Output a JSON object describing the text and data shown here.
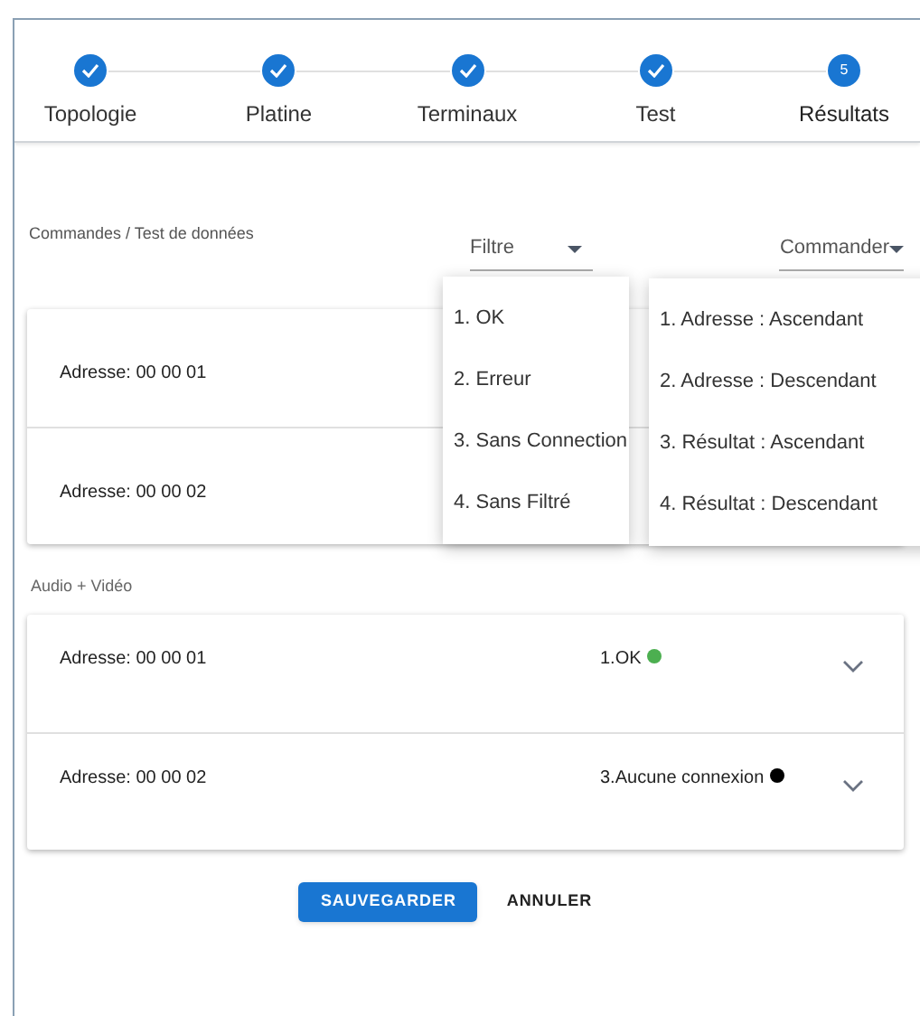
{
  "stepper": {
    "steps": [
      {
        "label": "Topologie",
        "completed": true
      },
      {
        "label": "Platine",
        "completed": true
      },
      {
        "label": "Terminaux",
        "completed": true
      },
      {
        "label": "Test",
        "completed": true
      },
      {
        "label": "Résultats",
        "completed": false,
        "number": "5"
      }
    ]
  },
  "commands_section": {
    "title": "Commandes / Test de données",
    "filter": {
      "label": "Filtre"
    },
    "sort": {
      "label": "Commander"
    },
    "rows": [
      {
        "address": "Adresse: 00 00 01"
      },
      {
        "address": "Adresse: 00 00 02"
      }
    ],
    "filter_menu": {
      "items": [
        {
          "label": "1. OK",
          "selected": false
        },
        {
          "label": "2. Erreur",
          "selected": false
        },
        {
          "label": "3. Sans Connection",
          "selected": false
        },
        {
          "label": "4. Sans Filtré",
          "selected": false
        }
      ]
    },
    "sort_menu": {
      "items": [
        {
          "label": "1. Adresse : Ascendant",
          "selected": false
        },
        {
          "label": "2. Adresse : Descendant",
          "selected": false
        },
        {
          "label": "3. Résultat : Ascendant",
          "selected": false
        },
        {
          "label": "4. Résultat : Descendant",
          "selected": false
        }
      ]
    }
  },
  "audio_video_section": {
    "title": "Audio + Vidéo",
    "rows": [
      {
        "address": "Adresse: 00 00 01",
        "status": "1.OK",
        "color": "#4caf50",
        "expanded": false
      },
      {
        "address": "Adresse: 00 00 02",
        "status": "3.Aucune connexion",
        "color": "#000000",
        "expanded": false
      }
    ]
  },
  "buttons": {
    "save": "SAUVEGARDER",
    "cancel": "ANNULER"
  }
}
